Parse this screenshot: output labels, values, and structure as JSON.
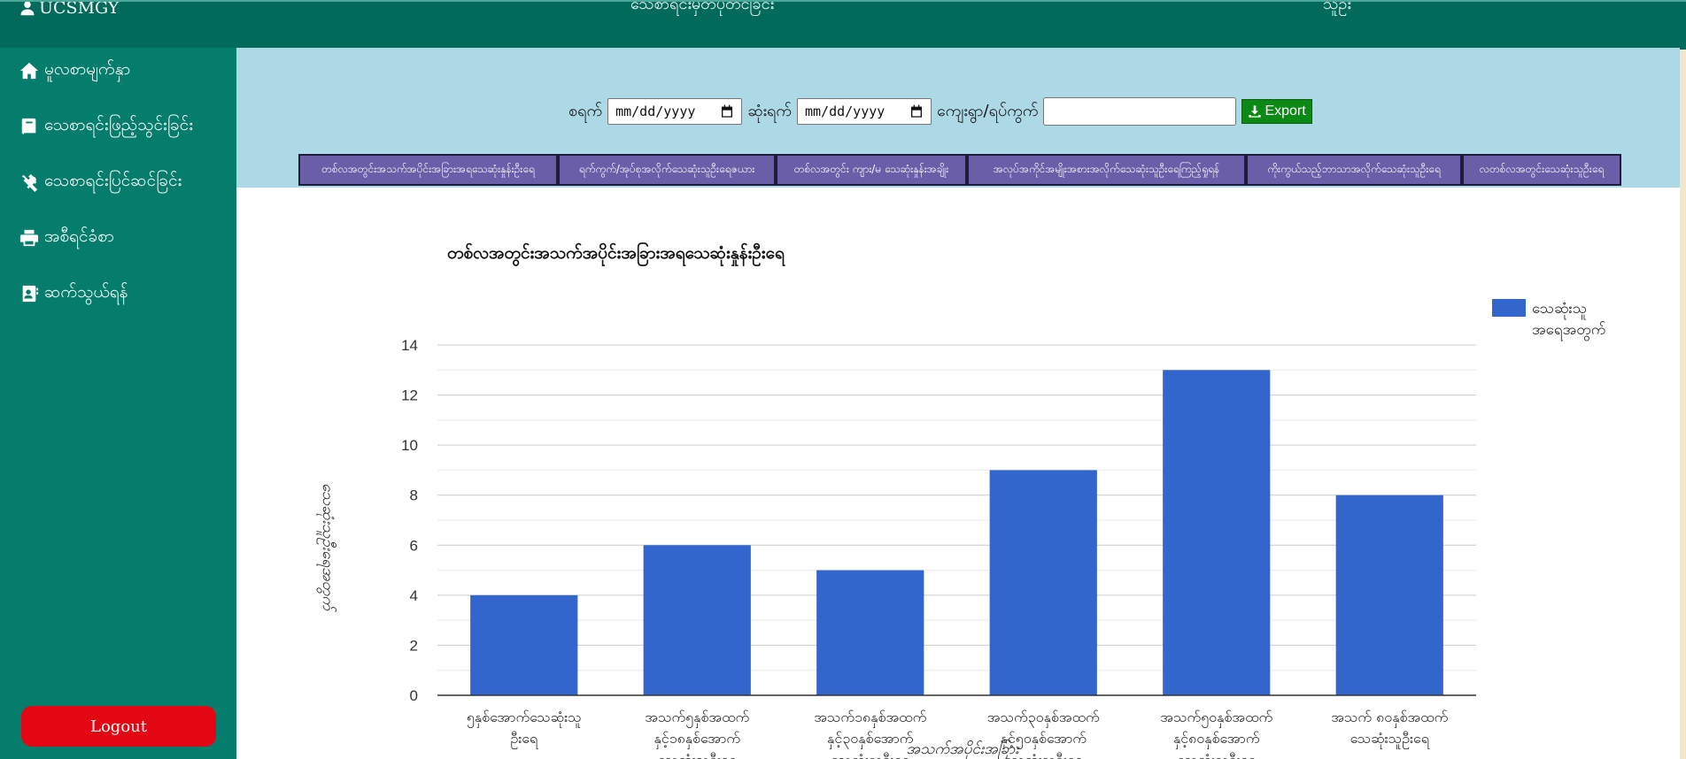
{
  "topbar": {
    "brand": "UCSMGY",
    "title": "သေစာရင်းမှတ်ပုံတင်ခြင်း",
    "user": "သူဦး"
  },
  "sidebar": {
    "items": [
      {
        "label": "မူလစာမျက်နှာ",
        "icon": "home-icon"
      },
      {
        "label": "သေစာရင်းဖြည့်သွင်းခြင်း",
        "icon": "book-icon"
      },
      {
        "label": "သေစာရင်းပြင်ဆင်ခြင်း",
        "icon": "tools-icon"
      },
      {
        "label": "အစီရင်ခံစာ",
        "icon": "printer-icon"
      },
      {
        "label": "ဆက်သွယ်ရန်",
        "icon": "contact-card-icon"
      }
    ],
    "logout_label": "Logout"
  },
  "filters": {
    "start_label": "စရက်",
    "start_placeholder": "mm/dd/yyyy",
    "end_label": "ဆုံးရက်",
    "end_placeholder": "mm/dd/yyyy",
    "village_label": "ကျေးရွာ/ရပ်ကွက်",
    "village_value": "",
    "export_label": "Export"
  },
  "tabs": [
    "တစ်လအတွင်းအသက်အပိုင်းအခြားအရသေဆုံးနှုန်းဦးရေ",
    "ရက်ကွက်/အုပ်စုအလိုက်သေဆုံးသူဦးရေဇယား",
    "တစ်လအတွင်း ကျား/မ သေဆုံးနှုန်းအချိုး",
    "အလုပ်အကိုင်အမျိုးအစားအလိုက်သေဆုံးသူဦးရေကြည့်ရှုရန်",
    "ကိုးကွယ်သည့်ဘာသာအလိုက်သေဆုံးသူဦးရေ",
    "လတစ်လအတွင်းသေဆုံးသူဦးရေ"
  ],
  "chart_data": {
    "type": "bar",
    "title": "တစ်လအတွင်းအသက်အပိုင်းအခြားအရသေဆုံးနှုန်းဦးရေ",
    "xlabel": "အသက်အပိုင်းအခြား",
    "ylabel": "သေဆုံးသူဦးရေအတွက်",
    "categories": [
      [
        "၅နှစ်အောက်သေဆုံးသူ",
        "ဦးရေ"
      ],
      [
        "အသက်၅နှစ်အထက်",
        "နှင့်၁၈နှစ်အောက်",
        "သေဆုံးသူဦးရေ"
      ],
      [
        "အသက်၁၈နှစ်အထက်",
        "နှင့်၃၀နှစ်အောက်",
        "သေဆုံးသူဦးရေ"
      ],
      [
        "အသက်၃၀နှစ်အထက်",
        "နှင့်၅၀နှစ်အောက်",
        "သေဆုံးသူဦးရေ"
      ],
      [
        "အသက်၅၀နှစ်အထက်",
        "နှင့်၈၀နှစ်အောက်",
        "သေဆုံးသူဦးရေ"
      ],
      [
        "အသက် ၈၀နှစ်အထက်",
        "သေဆုံးသူဦးရေ"
      ]
    ],
    "series": [
      {
        "name": "သေဆုံးသူ အရေအတွက်",
        "legend_lines": [
          "သေဆုံးသူ",
          "အရေအတွက်"
        ],
        "values": [
          4,
          6,
          5,
          9,
          13,
          8
        ],
        "color": "#3366cc"
      }
    ],
    "ylim": [
      0,
      14
    ],
    "yticks": [
      "0",
      "2",
      "4",
      "6",
      "8",
      "10",
      "12",
      "14"
    ],
    "grid": true,
    "legend": "right"
  },
  "colors": {
    "topbar": "#016a5a",
    "sidebar": "#047d6c",
    "filterbar": "#add8e6",
    "tab": "#6a5ea8",
    "export": "#0a8a14",
    "logout": "#e30613",
    "bar": "#3366cc"
  }
}
